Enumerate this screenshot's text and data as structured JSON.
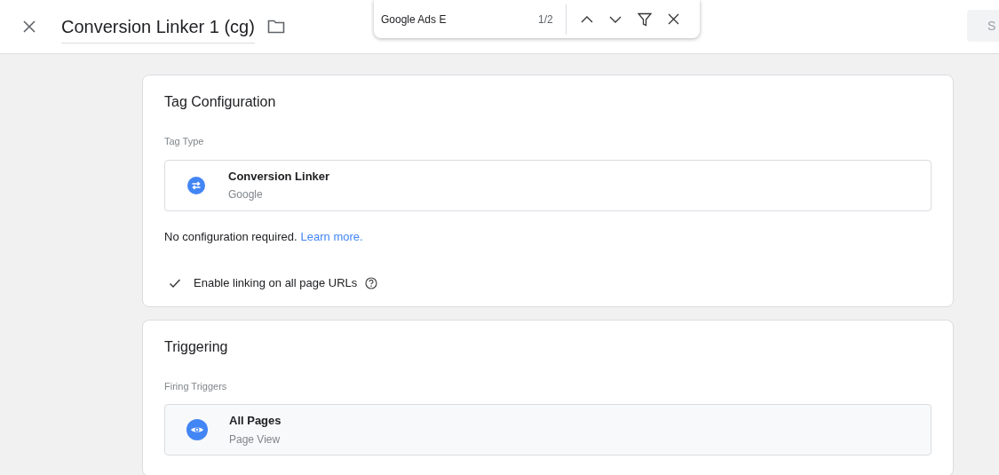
{
  "header": {
    "title": "Conversion Linker 1 (cg)",
    "save_button": "S"
  },
  "find_bar": {
    "query": "Google Ads E",
    "count": "1/2"
  },
  "tag_configuration": {
    "title": "Tag Configuration",
    "section_label": "Tag Type",
    "tag_type": {
      "name": "Conversion Linker",
      "vendor": "Google"
    },
    "note": "No configuration required.",
    "link": "Learn more.",
    "option": {
      "label": "Enable linking on all page URLs",
      "checked": true
    }
  },
  "triggering": {
    "title": "Triggering",
    "section_label": "Firing Triggers",
    "trigger": {
      "name": "All Pages",
      "type": "Page View"
    }
  }
}
